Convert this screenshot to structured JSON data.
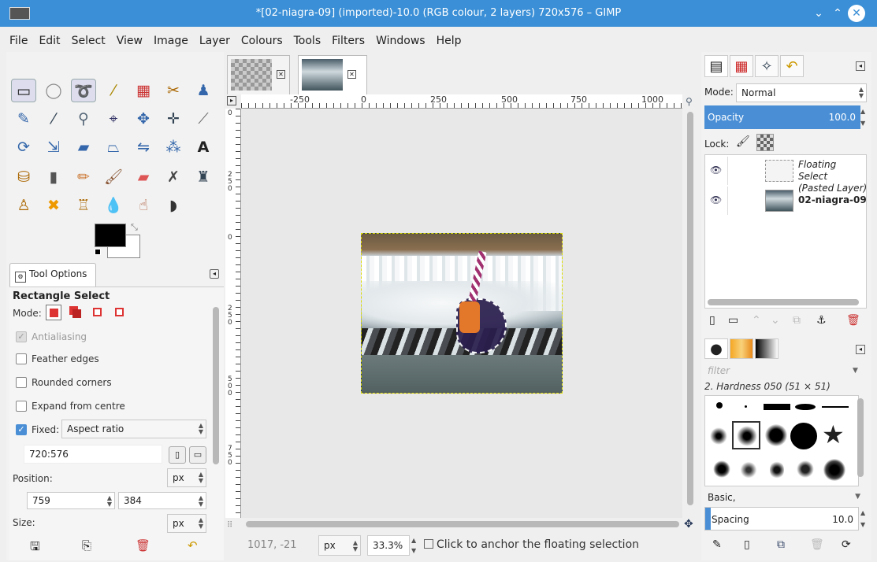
{
  "window": {
    "title": "*[02-niagra-09] (imported)-10.0 (RGB colour, 2 layers) 720x576 – GIMP"
  },
  "menu": [
    "File",
    "Edit",
    "Select",
    "View",
    "Image",
    "Layer",
    "Colours",
    "Tools",
    "Filters",
    "Windows",
    "Help"
  ],
  "toolbox": {
    "tool_options_tab": "Tool Options",
    "tool_name": "Rectangle Select",
    "mode_label": "Mode:",
    "antialiasing_label": "Antialiasing",
    "feather_label": "Feather edges",
    "rounded_label": "Rounded corners",
    "expand_label": "Expand from centre",
    "fixed_label": "Fixed:",
    "fixed_value": "Aspect ratio",
    "ratio_value": "720:576",
    "position_label": "Position:",
    "position_unit": "px",
    "position_x": "759",
    "position_y": "384",
    "size_label": "Size:",
    "size_unit": "px"
  },
  "canvas": {
    "ruler_labels": [
      "-250",
      "0",
      "250",
      "500",
      "750",
      "1000"
    ],
    "vruler_labels": [
      "0",
      "250",
      "0",
      "250",
      "500",
      "750"
    ],
    "coords": "1017, -21",
    "unit": "px",
    "zoom": "33.3%",
    "status": "Click to anchor the floating selection"
  },
  "layers_panel": {
    "mode_label": "Mode:",
    "mode_value": "Normal",
    "opacity_label": "Opacity",
    "opacity_value": "100.0",
    "lock_label": "Lock:",
    "layers": [
      {
        "name_line1": "Floating Select",
        "name_line2": "(Pasted Layer)"
      },
      {
        "name_line1": "02-niagra-09",
        "name_line2": ""
      }
    ]
  },
  "brushes_panel": {
    "filter_placeholder": "filter",
    "brush_name": "2. Hardness 050 (51 × 51)",
    "preset": "Basic,",
    "spacing_label": "Spacing",
    "spacing_value": "10.0"
  },
  "colors": {
    "titlebar": "#3a8fd6",
    "accent": "#4a8fd6",
    "foreground": "#000000",
    "background": "#ffffff"
  }
}
